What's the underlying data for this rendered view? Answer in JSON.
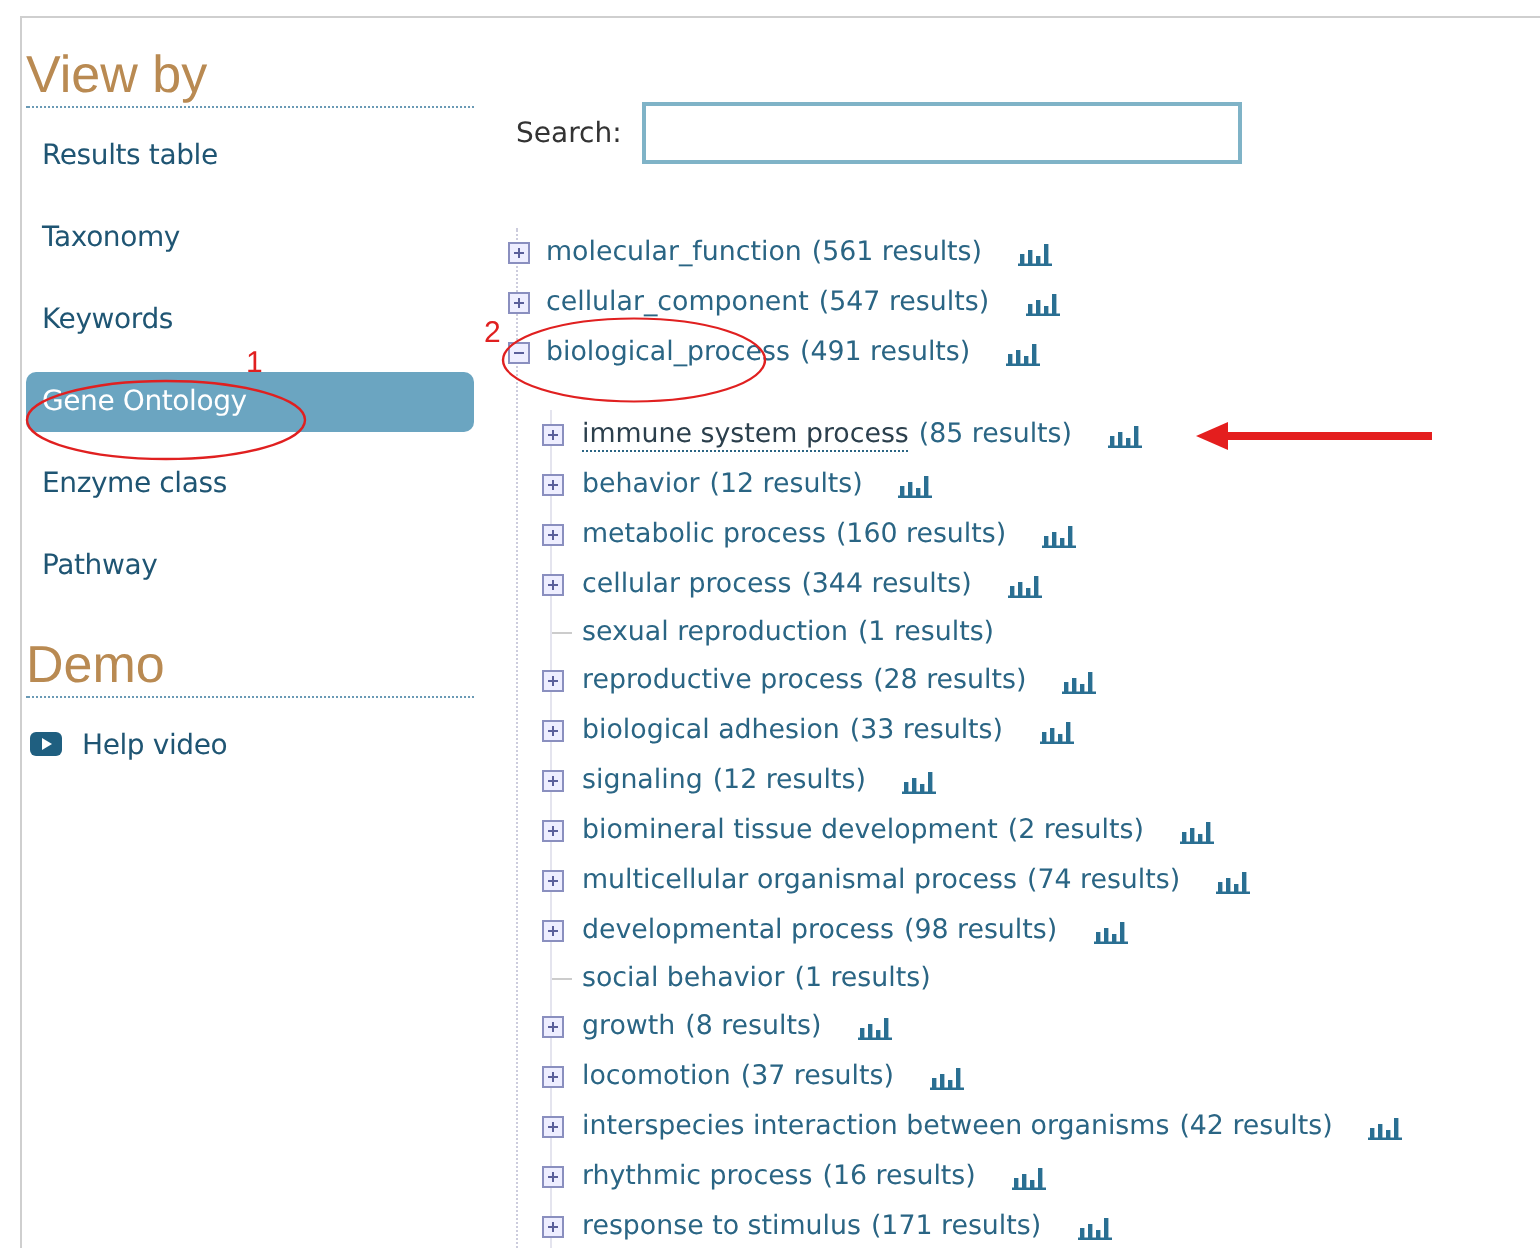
{
  "sidebar": {
    "sections": [
      {
        "heading": "View by",
        "items": [
          {
            "label": "Results table",
            "selected": false,
            "kind": "link"
          },
          {
            "label": "Taxonomy",
            "selected": false,
            "kind": "link"
          },
          {
            "label": "Keywords",
            "selected": false,
            "kind": "link"
          },
          {
            "label": "Gene Ontology",
            "selected": true,
            "kind": "link"
          },
          {
            "label": "Enzyme class",
            "selected": false,
            "kind": "link"
          },
          {
            "label": "Pathway",
            "selected": false,
            "kind": "link"
          }
        ]
      },
      {
        "heading": "Demo",
        "items": [
          {
            "label": "Help video",
            "selected": false,
            "kind": "video"
          }
        ]
      }
    ]
  },
  "search": {
    "label": "Search:"
  },
  "tree": [
    {
      "label": "molecular_function",
      "count": "(561 results)",
      "expanded": false,
      "kind": "branch"
    },
    {
      "label": "cellular_component",
      "count": "(547 results)",
      "expanded": false,
      "kind": "branch"
    },
    {
      "label": "biological_process",
      "count": "(491 results)",
      "expanded": true,
      "kind": "branch",
      "children": [
        {
          "label": "immune system process",
          "count": "(85 results)",
          "expanded": false,
          "kind": "branch",
          "hovered": true
        },
        {
          "label": "behavior",
          "count": "(12 results)",
          "expanded": false,
          "kind": "branch"
        },
        {
          "label": "metabolic process",
          "count": "(160 results)",
          "expanded": false,
          "kind": "branch"
        },
        {
          "label": "cellular process",
          "count": "(344 results)",
          "expanded": false,
          "kind": "branch"
        },
        {
          "label": "sexual reproduction",
          "count": "(1 results)",
          "kind": "leaf"
        },
        {
          "label": "reproductive process",
          "count": "(28 results)",
          "expanded": false,
          "kind": "branch"
        },
        {
          "label": "biological adhesion",
          "count": "(33 results)",
          "expanded": false,
          "kind": "branch"
        },
        {
          "label": "signaling",
          "count": "(12 results)",
          "expanded": false,
          "kind": "branch"
        },
        {
          "label": "biomineral tissue development",
          "count": "(2 results)",
          "expanded": false,
          "kind": "branch"
        },
        {
          "label": "multicellular organismal process",
          "count": "(74 results)",
          "expanded": false,
          "kind": "branch"
        },
        {
          "label": "developmental process",
          "count": "(98 results)",
          "expanded": false,
          "kind": "branch"
        },
        {
          "label": "social behavior",
          "count": "(1 results)",
          "kind": "leaf"
        },
        {
          "label": "growth",
          "count": "(8 results)",
          "expanded": false,
          "kind": "branch"
        },
        {
          "label": "locomotion",
          "count": "(37 results)",
          "expanded": false,
          "kind": "branch"
        },
        {
          "label": "interspecies interaction between organisms",
          "count": "(42 results)",
          "expanded": false,
          "kind": "branch"
        },
        {
          "label": "rhythmic process",
          "count": "(16 results)",
          "expanded": false,
          "kind": "branch"
        },
        {
          "label": "response to stimulus",
          "count": "(171 results)",
          "expanded": false,
          "kind": "branch"
        }
      ]
    }
  ],
  "annotations": {
    "labels": [
      "1",
      "2"
    ]
  }
}
